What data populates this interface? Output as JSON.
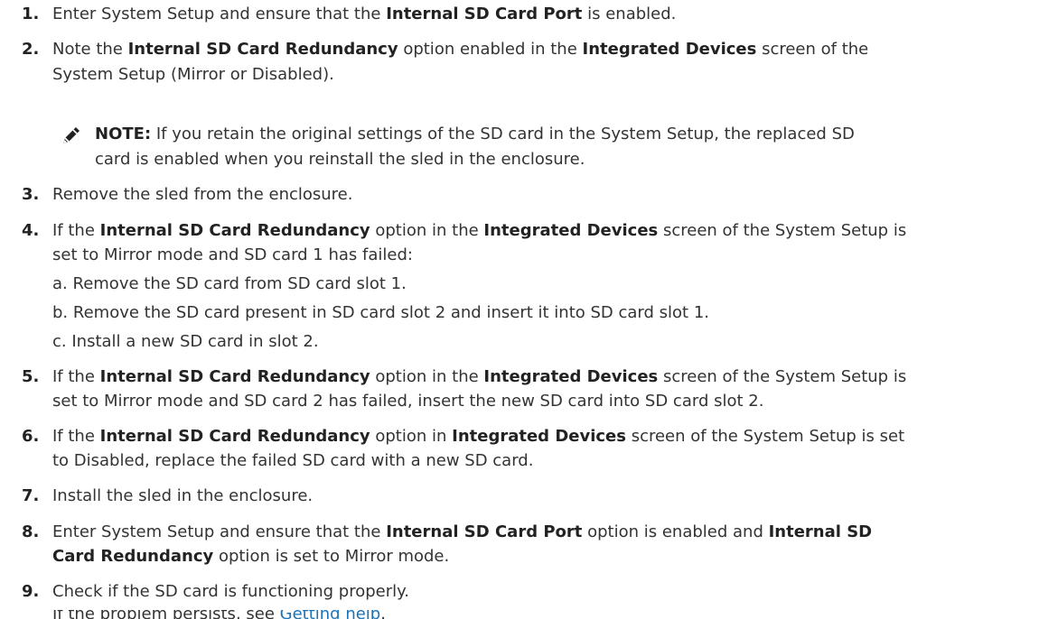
{
  "steps": [
    {
      "num": "1.",
      "l1": {
        "a": "Enter System Setup and ensure that the ",
        "b": "Internal SD Card Port",
        "c": " is enabled."
      }
    },
    {
      "num": "2.",
      "l1": {
        "a": "Note the ",
        "b": "Internal SD Card Redundancy",
        "c": " option enabled in the ",
        "d": "Integrated Devices",
        "e": " screen of the"
      },
      "l2": "System Setup (Mirror or Disabled)."
    },
    {
      "num": "3.",
      "text": "Remove the sled from the enclosure."
    },
    {
      "num": "4.",
      "l1": {
        "a": "If the ",
        "b": "Internal SD Card Redundancy",
        "c": " option in the ",
        "d": "Integrated Devices",
        "e": " screen of the System Setup is"
      },
      "l2": "set to Mirror mode and SD card 1 has failed:",
      "substeps": [
        {
          "label": "a.",
          "text": "Remove the SD card from SD card slot 1."
        },
        {
          "label": "b.",
          "text": "Remove the SD card present in SD card slot 2 and insert it into SD card slot 1."
        },
        {
          "label": "c.",
          "text": "Install a new SD card in slot 2."
        }
      ]
    },
    {
      "num": "5.",
      "l1": {
        "a": "If the ",
        "b": "Internal SD Card Redundancy",
        "c": " option in the ",
        "d": "Integrated Devices",
        "e": " screen of the System Setup is"
      },
      "l2": "set to Mirror mode and SD card 2 has failed, insert the new SD card into SD card slot 2."
    },
    {
      "num": "6.",
      "l1": {
        "a": "If the ",
        "b": "Internal SD Card Redundancy",
        "c": " option in ",
        "d": "Integrated Devices",
        "e": " screen of the System Setup is set"
      },
      "l2": "to Disabled, replace the failed SD card with a new SD card."
    },
    {
      "num": "7.",
      "text": "Install the sled in the enclosure."
    },
    {
      "num": "8.",
      "l1": {
        "a": "Enter System Setup and ensure that the ",
        "b": "Internal SD Card Port",
        "c": " option is enabled and ",
        "d": "Internal SD"
      },
      "l2": {
        "b": "Card Redundancy",
        "c": " option is set to Mirror mode."
      }
    },
    {
      "num": "9.",
      "text": "Check if the SD card is functioning properly.",
      "follow": {
        "a": "If the problem persists, see ",
        "link": "Getting help",
        "c": "."
      }
    }
  ],
  "note": {
    "icon": "pencil-note-icon",
    "label": "NOTE:",
    "l1": " If you retain the original settings of the SD card in the System Setup, the replaced SD",
    "l2": "card is enabled when you reinstall the sled in the enclosure."
  },
  "colors": {
    "text": "#333333",
    "link": "#1a73b8"
  }
}
